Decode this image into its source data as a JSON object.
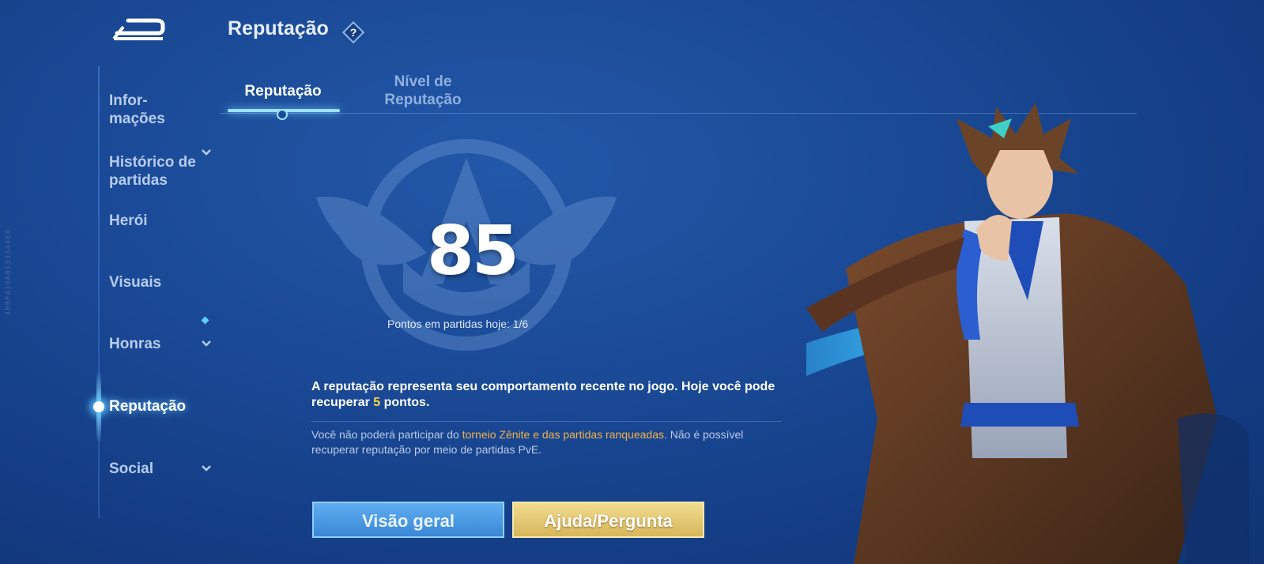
{
  "header": {
    "back_icon": "back-arrow-icon",
    "title": "Reputação",
    "help_icon": "question-diamond-icon",
    "help_label": "?"
  },
  "watermark": "4BBF410A8133344E8",
  "sidebar": {
    "items": [
      {
        "label": "Infor-\nmações",
        "has_chevron": false
      },
      {
        "label": "Histórico de\npartidas",
        "has_chevron": true
      },
      {
        "label": "Herói",
        "has_chevron": false
      },
      {
        "label": "Visuais",
        "has_chevron": false
      },
      {
        "label": "Honras",
        "has_chevron": true
      },
      {
        "label": "Reputação",
        "has_chevron": false,
        "active": true
      },
      {
        "label": "Social",
        "has_chevron": true
      }
    ]
  },
  "tabs": [
    {
      "label": "Reputação",
      "active": true
    },
    {
      "label": "Nível de\nReputação",
      "active": false
    }
  ],
  "reputation": {
    "score": "85",
    "points_today": "Pontos em partidas hoje: 1/6",
    "description_prefix": "A reputação representa seu comportamento recente no jogo. Hoje você pode recuperar ",
    "recoverable_points": "5",
    "description_suffix": " pontos.",
    "note_prefix": "Você não poderá participar do ",
    "note_highlight": "torneio Zênite e das partidas ranqueadas",
    "note_suffix": ". Não é possível recuperar reputação por meio de partidas PvE."
  },
  "buttons": {
    "overview_label": "Visão geral",
    "help_label": "Ajuda/Pergunta"
  },
  "colors": {
    "background": "#1b4b98",
    "accent_cyan": "#9be3ff",
    "highlight_yellow": "#ffd54a",
    "highlight_orange": "#f2b24b",
    "overview_button": "#4c9ae2",
    "help_button": "#e3c674"
  }
}
